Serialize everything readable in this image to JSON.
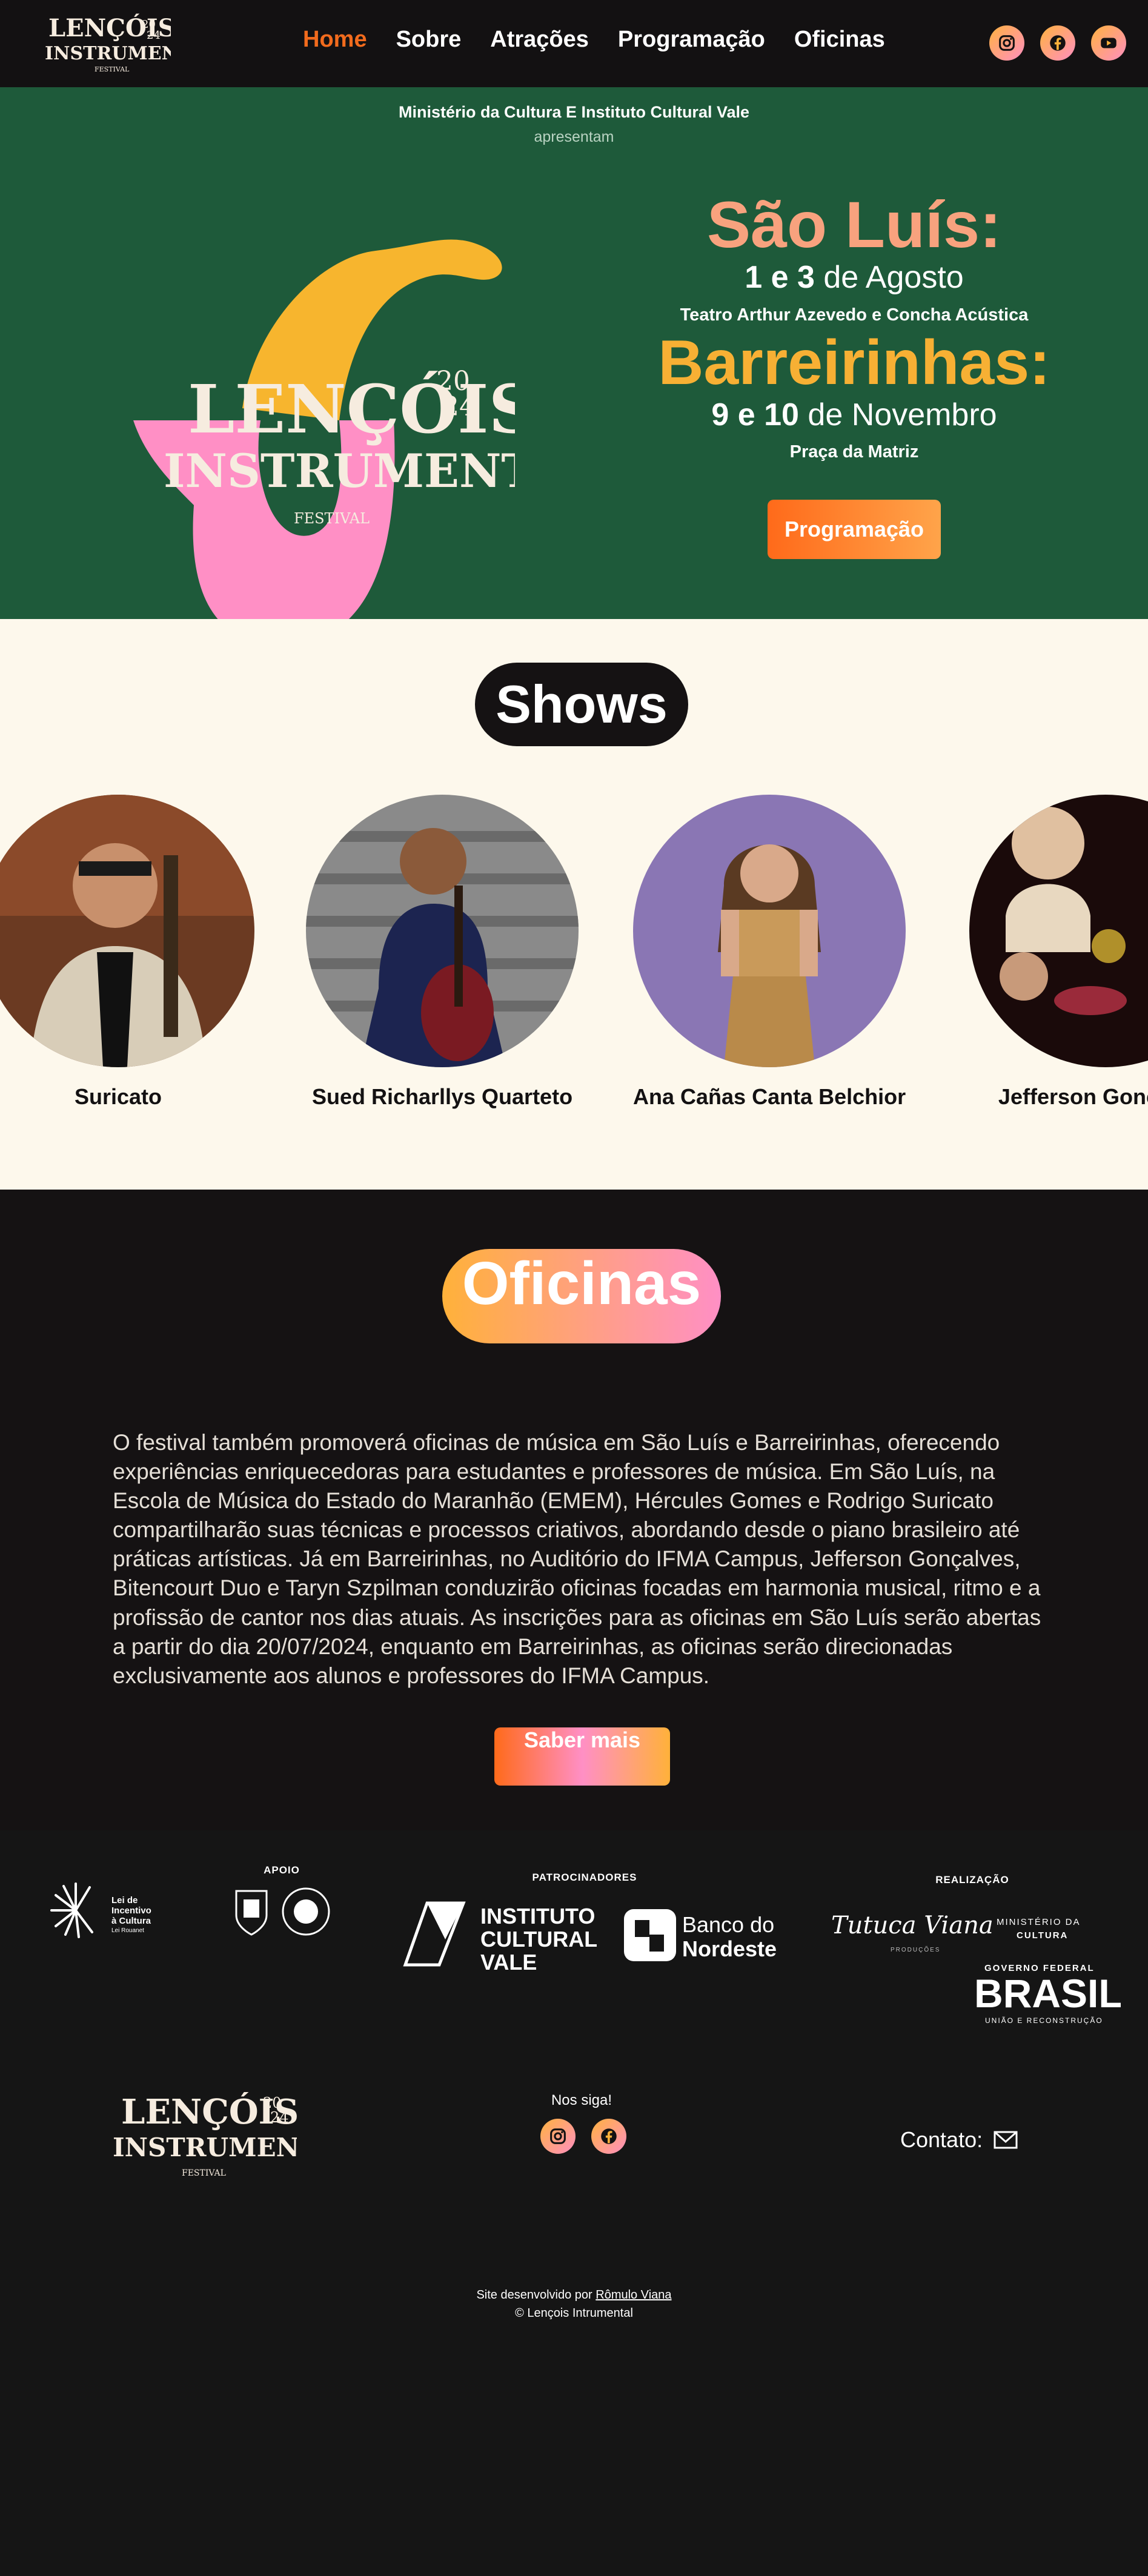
{
  "nav": {
    "brand": "LENÇÓIS INSTRUMENTAL",
    "links": [
      "Home",
      "Sobre",
      "Atrações",
      "Programação",
      "Oficinas"
    ],
    "active": "Home"
  },
  "hero": {
    "presenters": "Ministério da Cultura E Instituto Cultural Vale",
    "subtitle": "apresentam",
    "city1": "São Luís:",
    "city1_dates_bold": "1 e 3",
    "city1_dates_rest": " de Agosto",
    "city1_venue": "Teatro Arthur Azevedo e Concha Acústica",
    "city2": "Barreirinhas:",
    "city2_dates_bold": "9 e 10",
    "city2_dates_rest": " de Novembro",
    "city2_venue": "Praça da Matriz",
    "cta": "Programação",
    "logo_lines": [
      "LENÇÓIS",
      "INSTRUMENTAL",
      "FESTIVAL",
      "20",
      "24"
    ]
  },
  "shows": {
    "title": "Shows",
    "artists": [
      {
        "name": "Suricato"
      },
      {
        "name": "Sued Richarllys Quarteto"
      },
      {
        "name": "Ana Cañas Canta Belchior"
      },
      {
        "name": "Jefferson Gonçalves"
      }
    ]
  },
  "oficinas": {
    "title": "Oficinas",
    "text": "O festival também promoverá oficinas de música em São Luís e Barreirinhas, oferecendo experiências enriquecedoras para estudantes e professores de música. Em São Luís, na Escola de Música do Estado do Maranhão (EMEM), Hércules Gomes e Rodrigo Suricato compartilharão suas técnicas e processos criativos, abordando desde o piano brasileiro até práticas artísticas. Já em Barreirinhas, no Auditório do IFMA Campus, Jefferson Gonçalves, Bitencourt Duo e Taryn Szpilman conduzirão oficinas focadas em harmonia musical, ritmo e a profissão de cantor nos dias atuais. As inscrições para as oficinas em São Luís serão abertas a partir do dia 20/07/2024, enquanto em Barreirinhas, as oficinas serão direcionadas exclusivamente aos alunos e professores do IFMA Campus.",
    "button": "Saber mais"
  },
  "sponsors": {
    "apoio_label": "APOIO",
    "patrocinadores_label": "PATROCINADORES",
    "realizacao_label": "REALIZAÇÃO",
    "lei_incentivo": [
      "Lei de",
      "Incentivo",
      "à Cultura",
      "Lei Rouanet"
    ],
    "instituto": [
      "INSTITUTO",
      "CULTURAL",
      "VALE"
    ],
    "banco": [
      "Banco do",
      "Nordeste"
    ],
    "tutuca": "Tutuca Viana",
    "tutuca_sub": "PRODUÇÕES",
    "ministerio": [
      "MINISTÉRIO DA",
      "CULTURA"
    ],
    "governo": "GOVERNO FEDERAL",
    "brasil": "BRASIL",
    "brasil_sub": "UNIÃO E RECONSTRUÇÃO"
  },
  "footer": {
    "follow": "Nos siga!",
    "contact": "Contato:",
    "credits_prefix": "Site desenvolvido por ",
    "credits_author": "Rômulo Viana",
    "copyright": "© Lençois Intrumental"
  },
  "colors": {
    "nav_bg": "#131112",
    "hero_bg": "#1e5a3a",
    "active_link": "#f26b1d",
    "pink": "#ff8fc5",
    "yellow": "#ffb13a",
    "cream": "#fdf8ec",
    "dark": "#151213"
  }
}
